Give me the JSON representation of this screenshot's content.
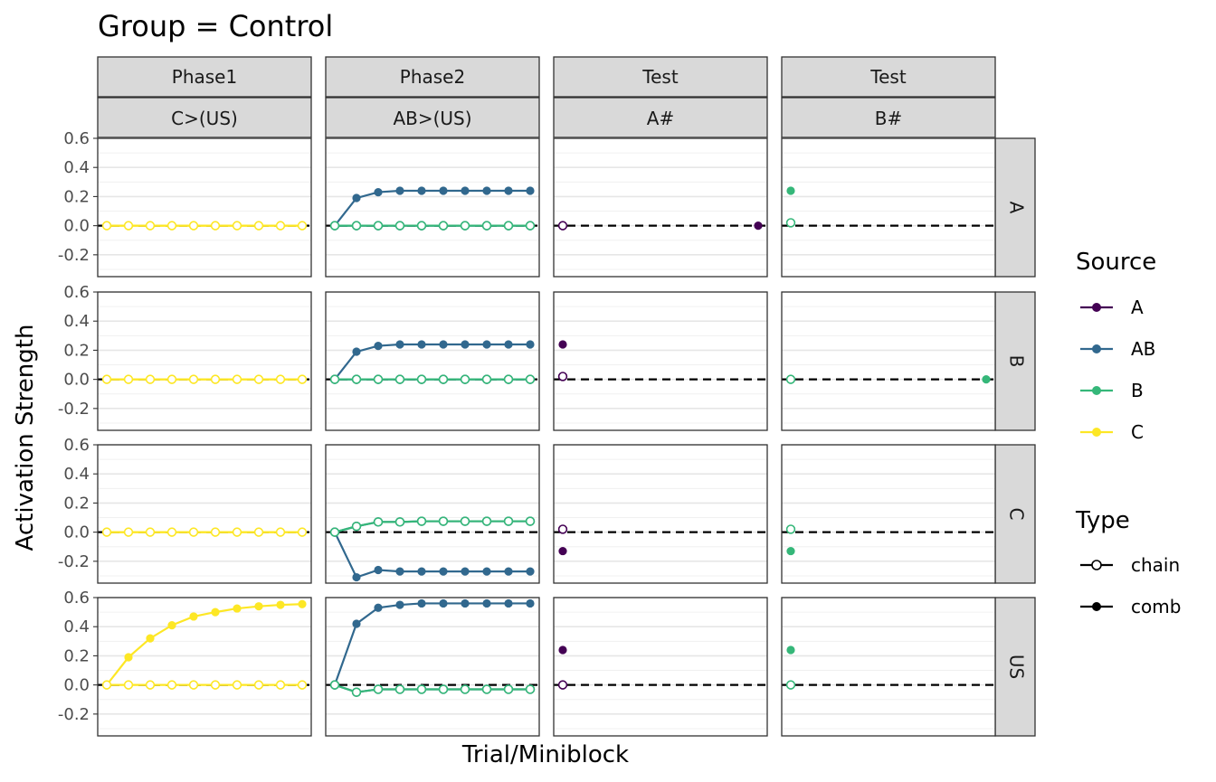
{
  "chart_data": {
    "type": "line",
    "title": "Group = Control",
    "xlabel": "Trial/Miniblock",
    "ylabel": "Activation Strength",
    "ylim": [
      -0.35,
      0.6
    ],
    "yticks": [
      -0.2,
      0.0,
      0.2,
      0.4,
      0.6
    ],
    "ytick_labels": [
      "-0.2",
      "0.0",
      "0.2",
      "0.4",
      "0.6"
    ],
    "grid": true,
    "reference_line": {
      "y": 0,
      "style": "dashed"
    },
    "columns": [
      {
        "phase": "Phase1",
        "trial": "C>(US)"
      },
      {
        "phase": "Phase2",
        "trial": "AB>(US)"
      },
      {
        "phase": "Test",
        "trial": "A#"
      },
      {
        "phase": "Test",
        "trial": "B#"
      }
    ],
    "rows": [
      "A",
      "B",
      "C",
      "US"
    ],
    "legend": {
      "position": "right",
      "source_title": "Source",
      "source": [
        {
          "name": "A",
          "color": "#440154"
        },
        {
          "name": "AB",
          "color": "#31688e"
        },
        {
          "name": "B",
          "color": "#35b779"
        },
        {
          "name": "C",
          "color": "#fde725"
        }
      ],
      "type_title": "Type",
      "type": [
        {
          "name": "chain",
          "marker": "open-circle"
        },
        {
          "name": "comb",
          "marker": "filled-circle"
        }
      ]
    },
    "panels": [
      {
        "row": "A",
        "col": 0,
        "series": [
          {
            "source": "C",
            "type": "comb",
            "x": [
              1,
              2,
              3,
              4,
              5,
              6,
              7,
              8,
              9,
              10
            ],
            "y": [
              0,
              0,
              0,
              0,
              0,
              0,
              0,
              0,
              0,
              0
            ]
          },
          {
            "source": "C",
            "type": "chain",
            "x": [
              1,
              2,
              3,
              4,
              5,
              6,
              7,
              8,
              9,
              10
            ],
            "y": [
              0,
              0,
              0,
              0,
              0,
              0,
              0,
              0,
              0,
              0
            ]
          }
        ]
      },
      {
        "row": "A",
        "col": 1,
        "series": [
          {
            "source": "AB",
            "type": "comb",
            "x": [
              1,
              2,
              3,
              4,
              5,
              6,
              7,
              8,
              9,
              10
            ],
            "y": [
              0,
              0.19,
              0.23,
              0.24,
              0.24,
              0.24,
              0.24,
              0.24,
              0.24,
              0.24
            ]
          },
          {
            "source": "AB",
            "type": "chain",
            "x": [
              1,
              2,
              3,
              4,
              5,
              6,
              7,
              8,
              9,
              10
            ],
            "y": [
              0,
              0,
              0,
              0,
              0,
              0,
              0,
              0,
              0,
              0
            ]
          },
          {
            "source": "B",
            "type": "chain",
            "x": [
              1,
              2,
              3,
              4,
              5,
              6,
              7,
              8,
              9,
              10
            ],
            "y": [
              0,
              0,
              0,
              0,
              0,
              0,
              0,
              0,
              0,
              0
            ]
          }
        ]
      },
      {
        "row": "A",
        "col": 2,
        "series": [
          {
            "source": "A",
            "type": "chain",
            "x": [
              1
            ],
            "y": [
              0
            ]
          },
          {
            "source": "A",
            "type": "comb",
            "x": [
              10
            ],
            "y": [
              0
            ]
          }
        ]
      },
      {
        "row": "A",
        "col": 3,
        "series": [
          {
            "source": "B",
            "type": "comb",
            "x": [
              1
            ],
            "y": [
              0.24
            ]
          },
          {
            "source": "B",
            "type": "chain",
            "x": [
              1
            ],
            "y": [
              0.02
            ]
          }
        ]
      },
      {
        "row": "B",
        "col": 0,
        "series": [
          {
            "source": "C",
            "type": "comb",
            "x": [
              1,
              2,
              3,
              4,
              5,
              6,
              7,
              8,
              9,
              10
            ],
            "y": [
              0,
              0,
              0,
              0,
              0,
              0,
              0,
              0,
              0,
              0
            ]
          },
          {
            "source": "C",
            "type": "chain",
            "x": [
              1,
              2,
              3,
              4,
              5,
              6,
              7,
              8,
              9,
              10
            ],
            "y": [
              0,
              0,
              0,
              0,
              0,
              0,
              0,
              0,
              0,
              0
            ]
          }
        ]
      },
      {
        "row": "B",
        "col": 1,
        "series": [
          {
            "source": "AB",
            "type": "comb",
            "x": [
              1,
              2,
              3,
              4,
              5,
              6,
              7,
              8,
              9,
              10
            ],
            "y": [
              0,
              0.19,
              0.23,
              0.24,
              0.24,
              0.24,
              0.24,
              0.24,
              0.24,
              0.24
            ]
          },
          {
            "source": "AB",
            "type": "chain",
            "x": [
              1,
              2,
              3,
              4,
              5,
              6,
              7,
              8,
              9,
              10
            ],
            "y": [
              0,
              0,
              0,
              0,
              0,
              0,
              0,
              0,
              0,
              0
            ]
          },
          {
            "source": "B",
            "type": "chain",
            "x": [
              1,
              2,
              3,
              4,
              5,
              6,
              7,
              8,
              9,
              10
            ],
            "y": [
              0,
              0,
              0,
              0,
              0,
              0,
              0,
              0,
              0,
              0
            ]
          }
        ]
      },
      {
        "row": "B",
        "col": 2,
        "series": [
          {
            "source": "A",
            "type": "comb",
            "x": [
              1
            ],
            "y": [
              0.24
            ]
          },
          {
            "source": "A",
            "type": "chain",
            "x": [
              1
            ],
            "y": [
              0.02
            ]
          }
        ]
      },
      {
        "row": "B",
        "col": 3,
        "series": [
          {
            "source": "B",
            "type": "chain",
            "x": [
              1
            ],
            "y": [
              0
            ]
          },
          {
            "source": "B",
            "type": "comb",
            "x": [
              10
            ],
            "y": [
              0
            ]
          }
        ]
      },
      {
        "row": "C",
        "col": 0,
        "series": [
          {
            "source": "C",
            "type": "comb",
            "x": [
              1,
              2,
              3,
              4,
              5,
              6,
              7,
              8,
              9,
              10
            ],
            "y": [
              0,
              0,
              0,
              0,
              0,
              0,
              0,
              0,
              0,
              0
            ]
          },
          {
            "source": "C",
            "type": "chain",
            "x": [
              1,
              2,
              3,
              4,
              5,
              6,
              7,
              8,
              9,
              10
            ],
            "y": [
              0,
              0,
              0,
              0,
              0,
              0,
              0,
              0,
              0,
              0
            ]
          }
        ]
      },
      {
        "row": "C",
        "col": 1,
        "series": [
          {
            "source": "AB",
            "type": "comb",
            "x": [
              1,
              2,
              3,
              4,
              5,
              6,
              7,
              8,
              9,
              10
            ],
            "y": [
              0,
              -0.31,
              -0.26,
              -0.27,
              -0.27,
              -0.27,
              -0.27,
              -0.27,
              -0.27,
              -0.27
            ]
          },
          {
            "source": "AB",
            "type": "chain",
            "x": [
              1,
              2,
              3,
              4,
              5,
              6,
              7,
              8,
              9,
              10
            ],
            "y": [
              0,
              0.04,
              0.07,
              0.07,
              0.075,
              0.075,
              0.075,
              0.075,
              0.075,
              0.075
            ]
          },
          {
            "source": "B",
            "type": "chain",
            "x": [
              1,
              2,
              3,
              4,
              5,
              6,
              7,
              8,
              9,
              10
            ],
            "y": [
              0,
              0.04,
              0.07,
              0.07,
              0.075,
              0.075,
              0.075,
              0.075,
              0.075,
              0.075
            ]
          }
        ]
      },
      {
        "row": "C",
        "col": 2,
        "series": [
          {
            "source": "A",
            "type": "chain",
            "x": [
              1
            ],
            "y": [
              0.02
            ]
          },
          {
            "source": "A",
            "type": "comb",
            "x": [
              1
            ],
            "y": [
              -0.13
            ]
          }
        ]
      },
      {
        "row": "C",
        "col": 3,
        "series": [
          {
            "source": "B",
            "type": "chain",
            "x": [
              1
            ],
            "y": [
              0.02
            ]
          },
          {
            "source": "B",
            "type": "comb",
            "x": [
              1
            ],
            "y": [
              -0.13
            ]
          }
        ]
      },
      {
        "row": "US",
        "col": 0,
        "series": [
          {
            "source": "C",
            "type": "comb",
            "x": [
              1,
              2,
              3,
              4,
              5,
              6,
              7,
              8,
              9,
              10
            ],
            "y": [
              0,
              0.19,
              0.32,
              0.41,
              0.47,
              0.5,
              0.525,
              0.54,
              0.55,
              0.555
            ]
          },
          {
            "source": "C",
            "type": "chain",
            "x": [
              1,
              2,
              3,
              4,
              5,
              6,
              7,
              8,
              9,
              10
            ],
            "y": [
              0,
              0,
              0,
              0,
              0,
              0,
              0,
              0,
              0,
              0
            ]
          }
        ]
      },
      {
        "row": "US",
        "col": 1,
        "series": [
          {
            "source": "AB",
            "type": "comb",
            "x": [
              1,
              2,
              3,
              4,
              5,
              6,
              7,
              8,
              9,
              10
            ],
            "y": [
              0,
              0.42,
              0.53,
              0.55,
              0.56,
              0.56,
              0.56,
              0.56,
              0.56,
              0.56
            ]
          },
          {
            "source": "AB",
            "type": "chain",
            "x": [
              1,
              2,
              3,
              4,
              5,
              6,
              7,
              8,
              9,
              10
            ],
            "y": [
              0,
              -0.05,
              -0.03,
              -0.03,
              -0.03,
              -0.03,
              -0.03,
              -0.03,
              -0.03,
              -0.03
            ]
          },
          {
            "source": "B",
            "type": "chain",
            "x": [
              1,
              2,
              3,
              4,
              5,
              6,
              7,
              8,
              9,
              10
            ],
            "y": [
              0,
              -0.05,
              -0.03,
              -0.03,
              -0.03,
              -0.03,
              -0.03,
              -0.03,
              -0.03,
              -0.03
            ]
          }
        ]
      },
      {
        "row": "US",
        "col": 2,
        "series": [
          {
            "source": "A",
            "type": "comb",
            "x": [
              1
            ],
            "y": [
              0.24
            ]
          },
          {
            "source": "A",
            "type": "chain",
            "x": [
              1
            ],
            "y": [
              0
            ]
          }
        ]
      },
      {
        "row": "US",
        "col": 3,
        "series": [
          {
            "source": "B",
            "type": "comb",
            "x": [
              1
            ],
            "y": [
              0.24
            ]
          },
          {
            "source": "B",
            "type": "chain",
            "x": [
              1
            ],
            "y": [
              0
            ]
          }
        ]
      }
    ]
  }
}
